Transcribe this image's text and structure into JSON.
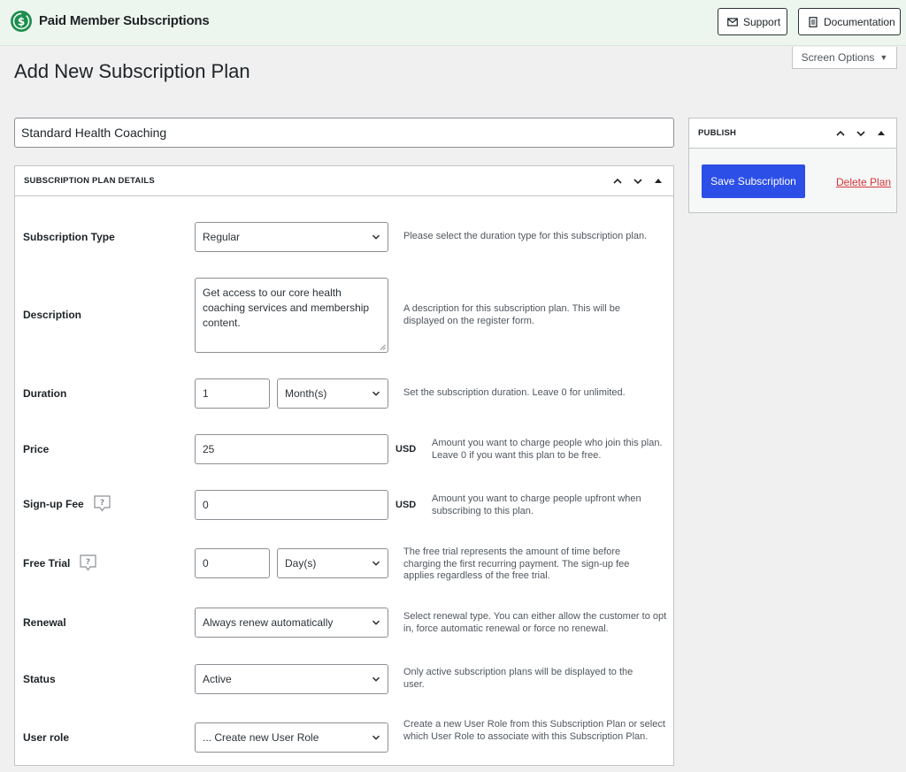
{
  "header": {
    "brand": "Paid Member Subscriptions",
    "support_label": "Support",
    "docs_label": "Documentation"
  },
  "screen_options": "Screen Options",
  "page_title": "Add New Subscription Plan",
  "plan_title": "Standard Health Coaching",
  "details_box": {
    "title": "SUBSCRIPTION PLAN DETAILS",
    "fields": {
      "subscription_type": {
        "label": "Subscription Type",
        "value": "Regular",
        "help": "Please select the duration type for this subscription plan."
      },
      "description": {
        "label": "Description",
        "value": "Get access to our core health coaching services and membership content.",
        "help": "A description for this subscription plan. This will be displayed on the register form."
      },
      "duration": {
        "label": "Duration",
        "value": "1",
        "unit": "Month(s)",
        "help": "Set the subscription duration. Leave 0 for unlimited."
      },
      "price": {
        "label": "Price",
        "value": "25",
        "currency": "USD",
        "help": "Amount you want to charge people who join this plan. Leave 0 if you want this plan to be free."
      },
      "signup_fee": {
        "label": "Sign-up Fee",
        "value": "0",
        "currency": "USD",
        "help": "Amount you want to charge people upfront when subscribing to this plan."
      },
      "free_trial": {
        "label": "Free Trial",
        "value": "0",
        "unit": "Day(s)",
        "help": "The free trial represents the amount of time before charging the first recurring payment. The sign-up fee applies regardless of the free trial."
      },
      "renewal": {
        "label": "Renewal",
        "value": "Always renew automatically",
        "help": "Select renewal type. You can either allow the customer to opt in, force automatic renewal or force no renewal."
      },
      "status": {
        "label": "Status",
        "value": "Active",
        "help": "Only active subscription plans will be displayed to the user."
      },
      "user_role": {
        "label": "User role",
        "value": "... Create new User Role",
        "help": "Create a new User Role from this Subscription Plan or select which User Role to associate with this Subscription Plan."
      }
    }
  },
  "publish_box": {
    "title": "PUBLISH",
    "save_label": "Save Subscription",
    "delete_label": "Delete Plan"
  },
  "icons": {
    "logo": "dollar-cycle-icon",
    "support": "envelope-icon",
    "docs": "document-icon",
    "help": "question-bubble-icon"
  },
  "colors": {
    "topbar_bg": "#edf6ee",
    "brand_green": "#1e8e4f",
    "primary_button": "#2c4fe8",
    "delete_link": "#d63638"
  }
}
